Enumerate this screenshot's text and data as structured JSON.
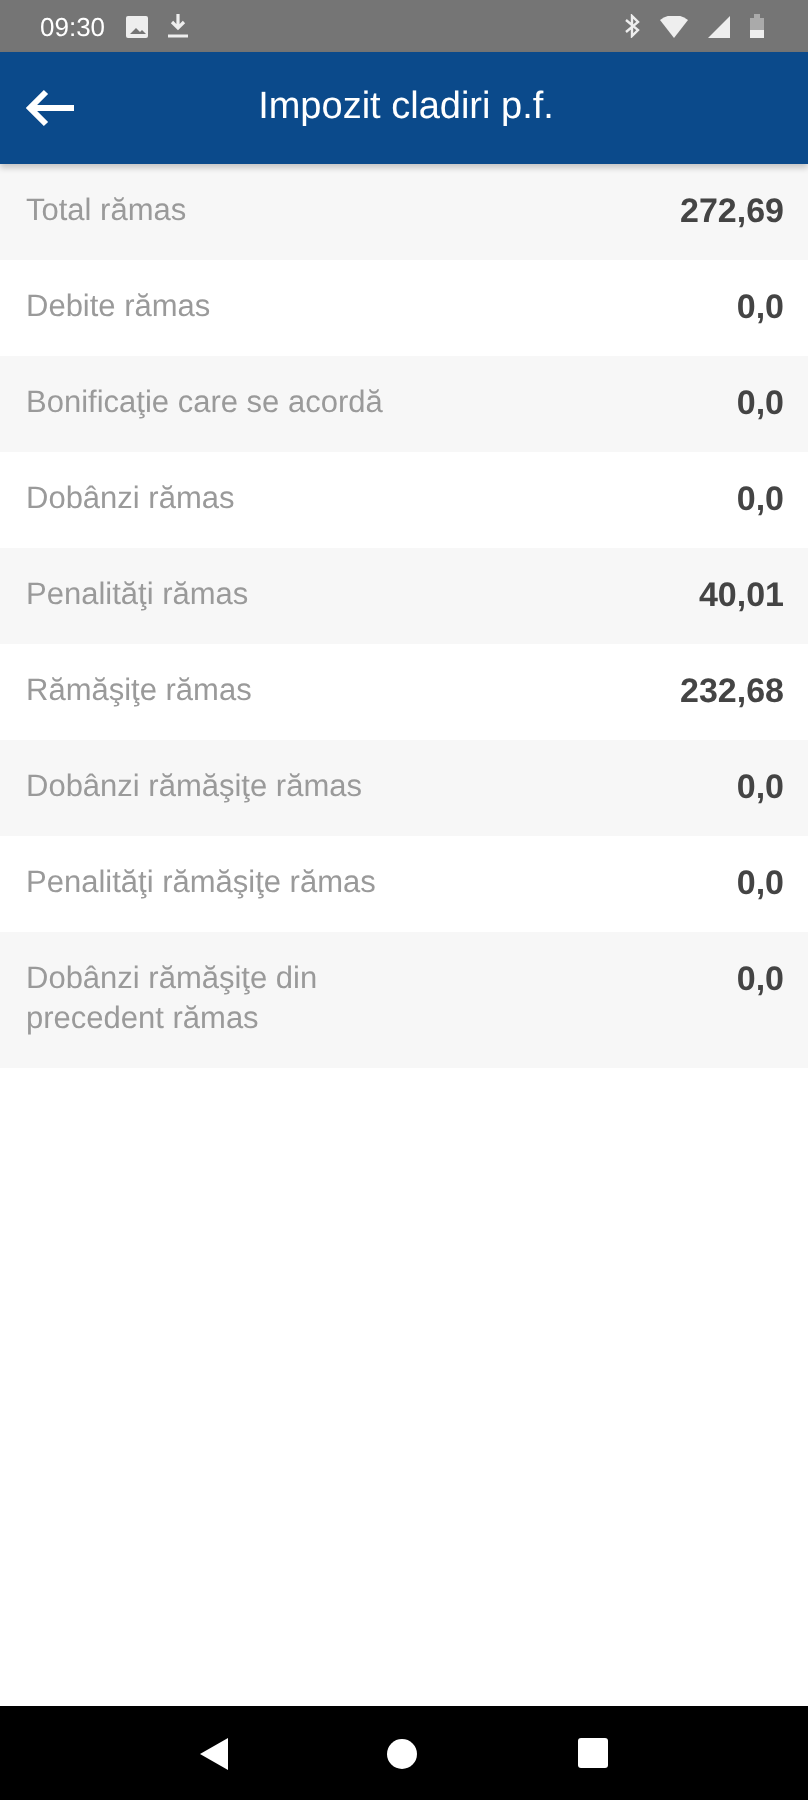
{
  "status_bar": {
    "time": "09:30"
  },
  "app_bar": {
    "title": "Impozit cladiri p.f."
  },
  "rows": [
    {
      "label": "Total rămas",
      "value": "272,69"
    },
    {
      "label": "Debite rămas",
      "value": "0,0"
    },
    {
      "label": "Bonificaţie care se acordă",
      "value": "0,0"
    },
    {
      "label": "Dobânzi rămas",
      "value": "0,0"
    },
    {
      "label": "Penalităţi rămas",
      "value": "40,01"
    },
    {
      "label": "Rămăşiţe rămas",
      "value": "232,68"
    },
    {
      "label": "Dobânzi rămăşiţe rămas",
      "value": "0,0"
    },
    {
      "label": "Penalităţi rămăşiţe rămas",
      "value": "0,0"
    },
    {
      "label": "Dobânzi rămăşiţe din precedent rămas",
      "value": "0,0"
    }
  ]
}
